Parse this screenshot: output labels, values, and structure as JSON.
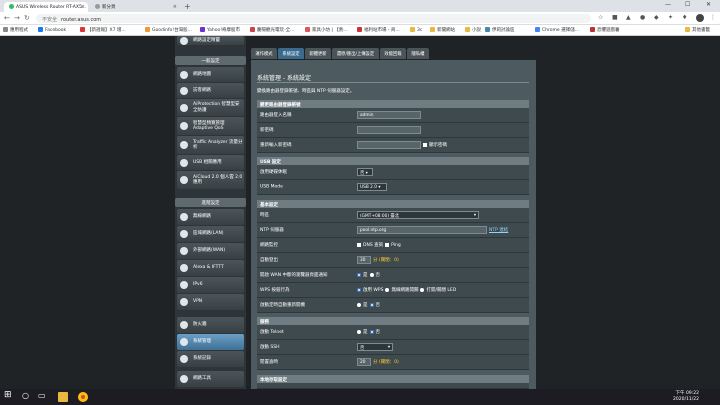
{
  "browser": {
    "tabs": [
      {
        "label": "ASUS Wireless Router RT-AX5...",
        "active": true
      },
      {
        "label": "新分頁",
        "active": false
      }
    ],
    "url": "router.asus.com",
    "security": "不安全"
  },
  "bookmarks": [
    "應用程式",
    "Facebook",
    "【新週報】X7 增...",
    "Goodinfo!台灣股...",
    "Yahoo!奇摩股市",
    "慶陽觀光電玩-全...",
    "家具小坊 | 【熱...",
    "福利站市場 - 商...",
    "3c",
    "新聞網站",
    "小說",
    "伊莉討論區",
    "Chrome 選擇儲...",
    "恐懼遊戲薯",
    "其他書籤"
  ],
  "sidebar": {
    "top_item": "網路設定精靈",
    "general_label": "一般設定",
    "general": [
      "網路地圖",
      "訪客網路",
      "AiProtection 智慧型安全防護",
      "智慧型頻寬管理 Adaptive QoS",
      "Traffic Analyzer 流量分析",
      "USB 相關應用",
      "AiCloud 2.0 個人雲 2.0 應用"
    ],
    "advanced_label": "進階設定",
    "advanced": [
      "無線網路",
      "區域網路(LAN)",
      "外部網路(WAN)",
      "Alexa & IFTTT",
      "IPv6",
      "VPN",
      "防火牆",
      "系統管理",
      "系統記錄",
      "網路工具"
    ]
  },
  "page_tabs": [
    "運作模式",
    "系統設定",
    "韌體更新",
    "還原/匯出/上傳設定",
    "效能回報",
    "隱私權"
  ],
  "title": "系統管理 - 系統設定",
  "description": "變換路由器登錄帳號、時區與 NTP 伺服器設定。",
  "sections": {
    "account": {
      "header": "變更路由器登錄帳號",
      "username_label": "路由器登入名稱",
      "username": "admin",
      "newpass_label": "新密碼",
      "retype_label": "重新輸入新密碼",
      "show_pass": "顯示密碼"
    },
    "usb": {
      "header": "USB 設定",
      "hibernation_label": "啟用硬碟休眠",
      "hibernation": "否",
      "mode_label": "USB Mode",
      "mode": "USB 2.0"
    },
    "basic": {
      "header": "基本設定",
      "timezone_label": "時區",
      "timezone": "(GMT+08:00) 臺北",
      "ntp_label": "NTP 伺服器",
      "ntp": "pool.ntp.org",
      "ntp_link": "NTP 連結",
      "monitor_label": "網路監控",
      "dns_query": "DNS 查詢",
      "ping": "Ping",
      "autologout_label": "自動登出",
      "autologout": "30",
      "autologout_hint": "分 (關閉：0)",
      "wan_notify_label": "開啟 WAN 中斷的瀏覽器頁面通知",
      "yes": "是",
      "no": "否",
      "wps_label": "WPS 按鈕行為",
      "wps_opt1": "啟用 WPS",
      "wps_opt2": "無線網路開關",
      "wps_opt3": "打開/關閉 LED",
      "reboot_label": "啟動定時自動重新開機"
    },
    "service": {
      "header": "服務",
      "telnet_label": "啟動 Telnet",
      "ssh_label": "啟動 SSH",
      "ssh": "否",
      "idle_label": "閒置逾時",
      "idle": "20",
      "idle_hint": "分 (關閉：0)"
    },
    "local": {
      "header": "本地存取設定"
    }
  },
  "taskbar": {
    "time": "下午 09:22",
    "date": "2020/11/22"
  }
}
